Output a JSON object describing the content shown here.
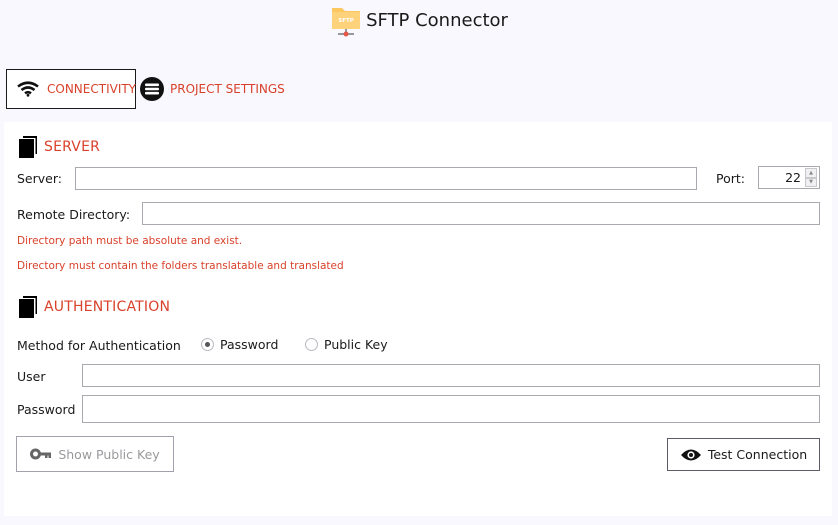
{
  "window": {
    "title": "SFTP Connector",
    "logo_icon": "sftp-folder-icon",
    "logo_text": "SFTP"
  },
  "tabs": [
    {
      "label": "CONNECTIVITY",
      "icon": "wifi-icon",
      "active": true
    },
    {
      "label": "PROJECT SETTINGS",
      "icon": "list-circle-icon",
      "active": false
    }
  ],
  "server_section": {
    "title": "SERVER",
    "icon": "copy-icon",
    "server_label": "Server:",
    "server_value": "",
    "port_label": "Port:",
    "port_value": "22",
    "remote_dir_label": "Remote Directory:",
    "remote_dir_value": "",
    "hints": [
      "Directory path must be absolute and exist.",
      "Directory must contain the folders translatable and translated"
    ]
  },
  "auth_section": {
    "title": "AUTHENTICATION",
    "icon": "copy-icon",
    "method_label": "Method for Authentication",
    "methods": [
      {
        "label": "Password",
        "selected": true
      },
      {
        "label": "Public Key",
        "selected": false
      }
    ],
    "user_label": "User",
    "user_value": "",
    "password_label": "Password",
    "password_value": ""
  },
  "buttons": {
    "show_public_key": {
      "label": "Show Public Key",
      "icon": "key-icon",
      "enabled": false
    },
    "test_connection": {
      "label": "Test Connection",
      "icon": "eye-icon",
      "enabled": true
    }
  },
  "colors": {
    "accent": "#d9412a",
    "background": "#f8f8fe",
    "panel": "#ffffff",
    "logo_folder": "#fcc75e"
  }
}
